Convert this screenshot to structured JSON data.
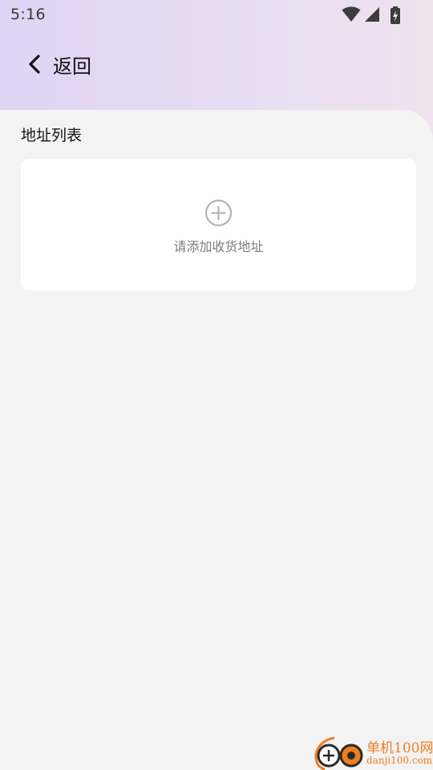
{
  "status_bar": {
    "time": "5:16",
    "icons": [
      "wifi-icon",
      "signal-icon",
      "battery-charging-icon"
    ]
  },
  "nav": {
    "back_icon": "chevron-left-icon",
    "back_label": "返回"
  },
  "address_list": {
    "section_title": "地址列表",
    "add_icon": "plus-circle-icon",
    "add_label": "请添加收货地址"
  },
  "watermark": {
    "brand_cn": "单机100网",
    "brand_url": "danji100.com"
  },
  "colors": {
    "header_gradient_start": "#e1d3f4",
    "header_gradient_end": "#efe2ef",
    "page_background": "#f3f3f4",
    "card_background": "#ffffff",
    "watermark_orange": "#f07d1f"
  }
}
